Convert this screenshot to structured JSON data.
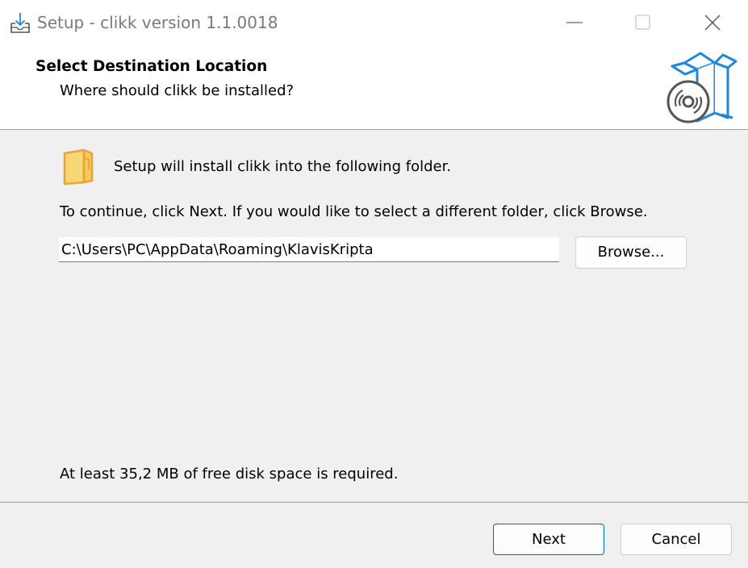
{
  "window": {
    "title": "Setup - clikk version 1.1.0018"
  },
  "icons": {
    "app": "download-tray-icon",
    "minimize": "minimize-icon",
    "maximize": "maximize-icon",
    "close": "close-icon",
    "header": "software-box-disc-icon",
    "folder": "folder-icon"
  },
  "header": {
    "title": "Select Destination Location",
    "subtitle": "Where should clikk be installed?"
  },
  "body": {
    "install_text": "Setup will install clikk into the following folder.",
    "continue_text": "To continue, click Next. If you would like to select a different folder, click Browse.",
    "path_value": "C:\\Users\\PC\\AppData\\Roaming\\KlavisKripta",
    "browse_label": "Browse...",
    "space_text": "At least 35,2 MB of free disk space is required."
  },
  "footer": {
    "next_label": "Next",
    "cancel_label": "Cancel"
  },
  "colors": {
    "accent": "#0067c0",
    "box_blue": "#1e88d8",
    "folder_yellow": "#f8d775",
    "folder_orange": "#e8a33d"
  }
}
